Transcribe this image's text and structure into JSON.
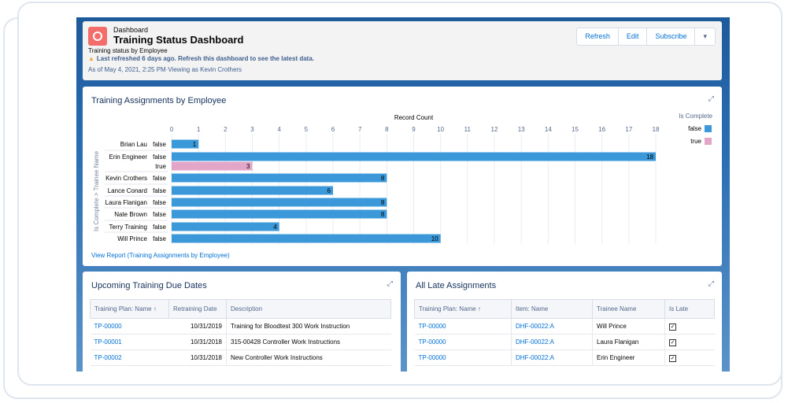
{
  "header": {
    "kicker": "Dashboard",
    "title": "Training Status Dashboard",
    "subtitle": "Training status by Employee",
    "warning": "Last refreshed 6 days ago. Refresh this dashboard to see the latest data.",
    "as_of": "As of May 4, 2021, 2:25 PM·Viewing as Kevin Crothers",
    "buttons": [
      "Refresh",
      "Edit",
      "Subscribe",
      "▾"
    ]
  },
  "chart_panel": {
    "title": "Training Assignments by Employee",
    "view_report": "View Report (Training Assignments by Employee)"
  },
  "chart_data": {
    "type": "bar",
    "orientation": "horizontal",
    "xlabel": "Record Count",
    "ylabel": "Is Complete  >  Trainee Name",
    "xlim": [
      0,
      18
    ],
    "xticks": [
      0,
      1,
      2,
      3,
      4,
      5,
      6,
      7,
      8,
      9,
      10,
      11,
      12,
      13,
      14,
      15,
      16,
      17,
      18
    ],
    "grid": true,
    "legend": {
      "title": "Is Complete",
      "position": "right",
      "entries": [
        {
          "name": "false",
          "color": "#3b99d9"
        },
        {
          "name": "true",
          "color": "#e2a7c8"
        }
      ]
    },
    "rows": [
      {
        "trainee": "Brian Lau",
        "complete": "false",
        "value": 1
      },
      {
        "trainee": "Erin Engineer",
        "complete": "false",
        "value": 18
      },
      {
        "trainee": "",
        "complete": "true",
        "value": 3
      },
      {
        "trainee": "Kevin Crothers",
        "complete": "false",
        "value": 8
      },
      {
        "trainee": "Lance Conard",
        "complete": "false",
        "value": 6
      },
      {
        "trainee": "Laura Flanigan",
        "complete": "false",
        "value": 8
      },
      {
        "trainee": "Nate Brown",
        "complete": "false",
        "value": 8
      },
      {
        "trainee": "Terry Training",
        "complete": "false",
        "value": 4
      },
      {
        "trainee": "Will Prince",
        "complete": "false",
        "value": 10
      }
    ]
  },
  "upcoming": {
    "title": "Upcoming Training Due Dates",
    "columns": [
      "Training Plan: Name ↑",
      "Retraining Date",
      "Description"
    ],
    "rows": [
      [
        "TP-00000",
        "10/31/2019",
        "Training for Bloodtest 300 Work Instruction"
      ],
      [
        "TP-00001",
        "10/31/2018",
        "315-00428 Controller Work Instructions"
      ],
      [
        "TP-00002",
        "10/31/2018",
        "New Controller Work Instructions"
      ]
    ]
  },
  "late": {
    "title": "All Late Assignments",
    "columns": [
      "Training Plan: Name ↑",
      "Item: Name",
      "Trainee Name",
      "Is Late"
    ],
    "rows": [
      [
        "TP-00000",
        "DHF-00022:A",
        "Will Prince",
        true
      ],
      [
        "TP-00000",
        "DHF-00022:A",
        "Laura Flanigan",
        true
      ],
      [
        "TP-00000",
        "DHF-00022:A",
        "Erin Engineer",
        true
      ]
    ]
  }
}
